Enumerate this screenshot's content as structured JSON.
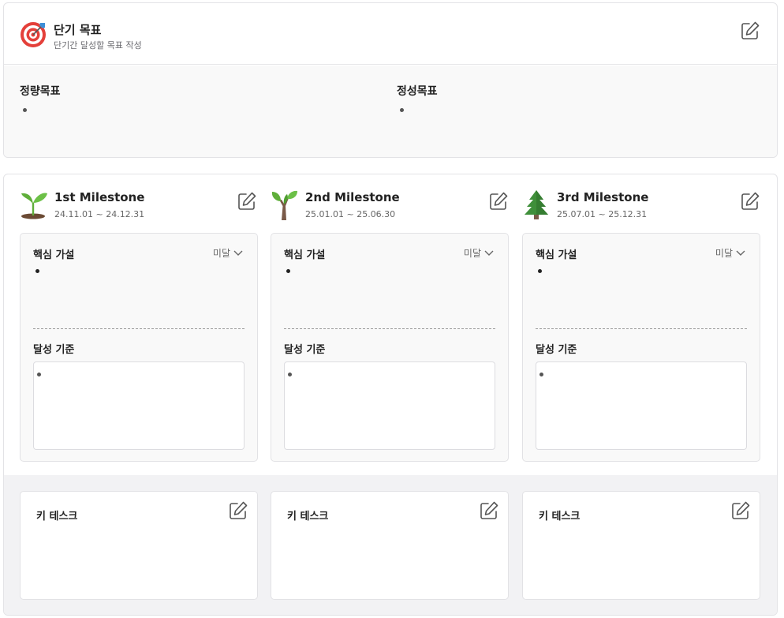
{
  "goal": {
    "title": "단기 목표",
    "subtitle": "단기간 달성할 목표 작성",
    "quantitative_label": "정량목표",
    "qualitative_label": "정성목표"
  },
  "milestones": [
    {
      "title": "1st Milestone",
      "dates": "24.11.01 ~ 24.12.31",
      "icon": "seedling-icon",
      "hypothesis_label": "핵심 가설",
      "status": "미달",
      "criteria_label": "달성 기준",
      "task_label": "키 테스크"
    },
    {
      "title": "2nd Milestone",
      "dates": "25.01.01 ~ 25.06.30",
      "icon": "sapling-icon",
      "hypothesis_label": "핵심 가설",
      "status": "미달",
      "criteria_label": "달성 기준",
      "task_label": "키 테스크"
    },
    {
      "title": "3rd Milestone",
      "dates": "25.07.01 ~ 25.12.31",
      "icon": "evergreen-tree-icon",
      "hypothesis_label": "핵심 가설",
      "status": "미달",
      "criteria_label": "달성 기준",
      "task_label": "키 테스크"
    }
  ],
  "colors": {
    "border": "#e3e3e6",
    "panel": "#f9f9f9",
    "task_zone": "#f2f2f4",
    "target_red": "#e4403a",
    "dart_blue": "#3d8fd8",
    "leaf_green": "#5fae3a",
    "tree_green": "#3f8f3a"
  }
}
